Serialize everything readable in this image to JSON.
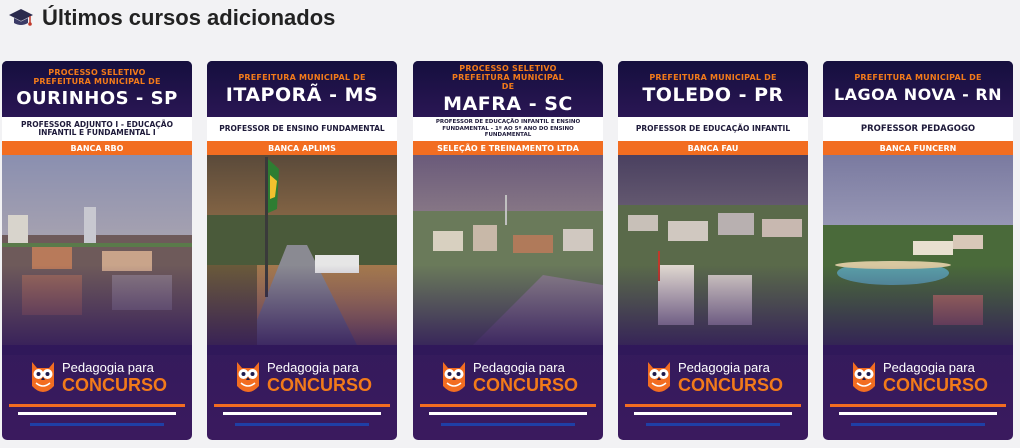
{
  "section": {
    "title": "Últimos cursos adicionados",
    "icon": "graduation-cap-icon"
  },
  "brand": {
    "line1": "Pedagogia para",
    "line2": "CONCURSO"
  },
  "colors": {
    "accent_orange": "#f26d21",
    "card_navy": "#1e1a4a",
    "card_purple": "#3a1a5e"
  },
  "cards": [
    {
      "kicker": "PROCESSO SELETIVO PREFEITURA MUNICIPAL DE",
      "city": "OURINHOS - SP",
      "role": "PROFESSOR ADJUNTO I - EDUCAÇÃO INFANTIL E FUNDAMENTAL I",
      "banca": "BANCA RBO"
    },
    {
      "kicker": "PREFEITURA MUNICIPAL DE",
      "city": "ITAPORÃ - MS",
      "role": "PROFESSOR DE ENSINO FUNDAMENTAL",
      "banca": "BANCA APLIMS"
    },
    {
      "kicker": "PROCESSO SELETIVO PREFEITURA MUNICIPAL DE",
      "city": "MAFRA - SC",
      "role": "PROFESSOR DE EDUCAÇÃO INFANTIL E ENSINO FUNDAMENTAL - 1º AO 5º ANO DO ENSINO FUNDAMENTAL",
      "banca": "SELEÇÃO E TREINAMENTO LTDA"
    },
    {
      "kicker": "PREFEITURA MUNICIPAL DE",
      "city": "TOLEDO - PR",
      "role": "PROFESSOR DE EDUCAÇÃO INFANTIL",
      "banca": "BANCA FAU"
    },
    {
      "kicker": "PREFEITURA MUNICIPAL DE",
      "city": "LAGOA NOVA - RN",
      "role": "PROFESSOR PEDAGOGO",
      "banca": "BANCA FUNCERN"
    }
  ]
}
